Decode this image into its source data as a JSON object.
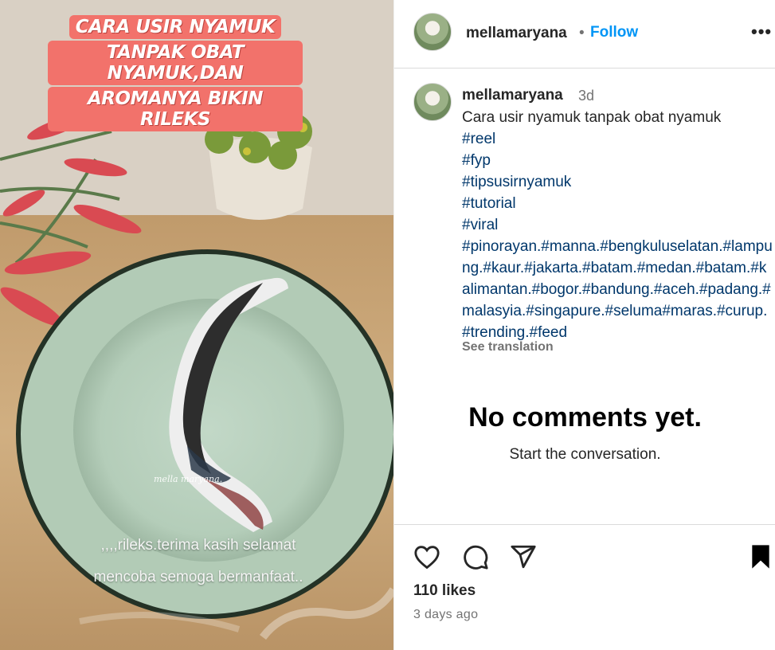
{
  "post": {
    "username": "mellamaryana",
    "follow_label": "Follow",
    "separator": "•",
    "more_label": "•••"
  },
  "media": {
    "title_lines": [
      "CARA USIR NYAMUK",
      "TANPAK OBAT NYAMUK,DAN",
      "AROMANYA BIKIN RILEKS"
    ],
    "watermark": "mella maryana.",
    "caption_lines": [
      ",,,,rileks.terima kasih selamat",
      "mencoba semoga bermanfaat.."
    ]
  },
  "caption": {
    "username": "mellamaryana",
    "time": "3d",
    "text": "Cara usir nyamuk tanpak obat nyamuk",
    "tags": [
      "#reel",
      "#fyp",
      "#tipsusirnyamuk",
      "#tutorial",
      "#viral"
    ],
    "tag_paragraph": "#pinorayan.#manna.#bengkuluselatan.#lampung.#kaur.#jakarta.#batam.#medan.#batam.#kalimantan.#bogor.#bandung.#aceh.#padang.#malasyia.#singapure.#seluma#maras.#curup.#trending.#feed",
    "see_translation": "See translation"
  },
  "comments": {
    "empty_title": "No comments yet.",
    "empty_subtitle": "Start the conversation."
  },
  "footer": {
    "likes": "110 likes",
    "time_ago": "3 days ago"
  },
  "icons": [
    "heart-icon",
    "comment-icon",
    "share-icon",
    "bookmark-icon",
    "more-icon"
  ],
  "colors": {
    "link_blue": "#0095f6",
    "hashtag": "#00376b",
    "title_banner": "#f2726b"
  }
}
